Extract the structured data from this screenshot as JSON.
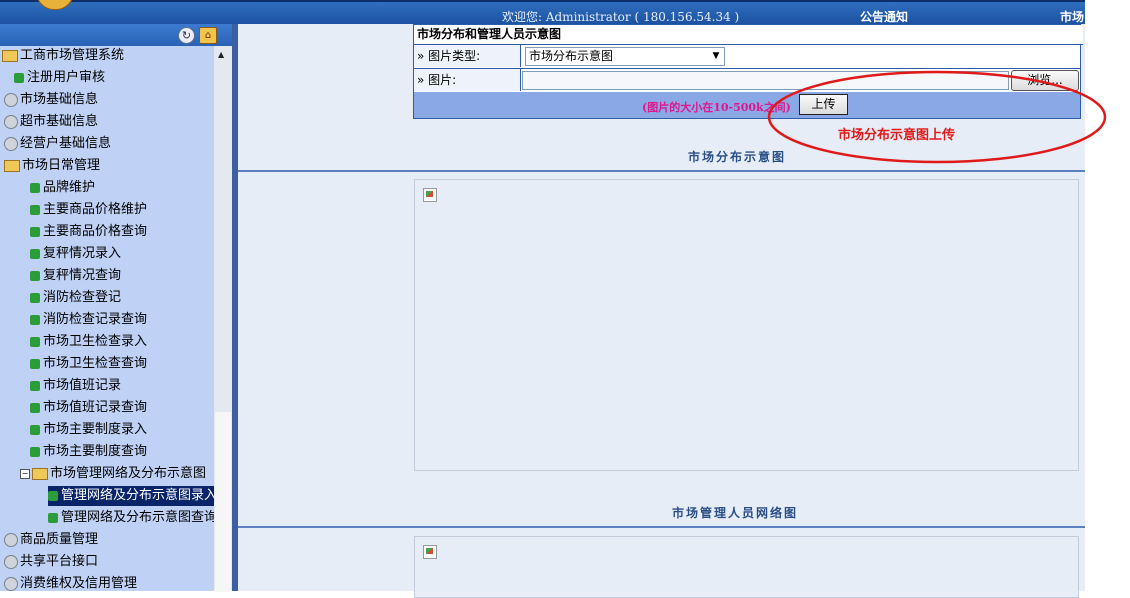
{
  "topbar": {
    "greeting": "欢迎您: Administrator ( 180.156.54.34 )",
    "notice_label": "公告通知",
    "market_label": "市场"
  },
  "tree": {
    "root": "工商市场管理系统",
    "items": [
      "注册用户审核",
      "市场基础信息",
      "超市基础信息",
      "经营户基础信息",
      "市场日常管理",
      "品牌维护",
      "主要商品价格维护",
      "主要商品价格查询",
      "复秤情况录入",
      "复秤情况查询",
      "消防检查登记",
      "消防检查记录查询",
      "市场卫生检查录入",
      "市场卫生检查查询",
      "市场值班记录",
      "市场值班记录查询",
      "市场主要制度录入",
      "市场主要制度查询",
      "市场管理网络及分布示意图",
      "管理网络及分布示意图录入",
      "管理网络及分布示意图查询",
      "商品质量管理",
      "共享平台接口",
      "消费维权及信用管理"
    ]
  },
  "form": {
    "title": "市场分布和管理人员示意图",
    "type_label": "» 图片类型:",
    "type_value": "市场分布示意图",
    "image_label": "» 图片:",
    "browse_label": "浏览...",
    "size_note": "(图片的大小在10-500k之间)",
    "upload_label": "上传"
  },
  "annotation": {
    "caption": "市场分布示意图上传",
    "color": "#e01a1a"
  },
  "sections": {
    "distribution_title": "市场分布示意图",
    "network_title": "市场管理人员网络图"
  },
  "icons": [
    "refresh-icon",
    "home-icon",
    "folder-icon",
    "gear-icon",
    "leaf-icon",
    "broken-image-icon"
  ]
}
